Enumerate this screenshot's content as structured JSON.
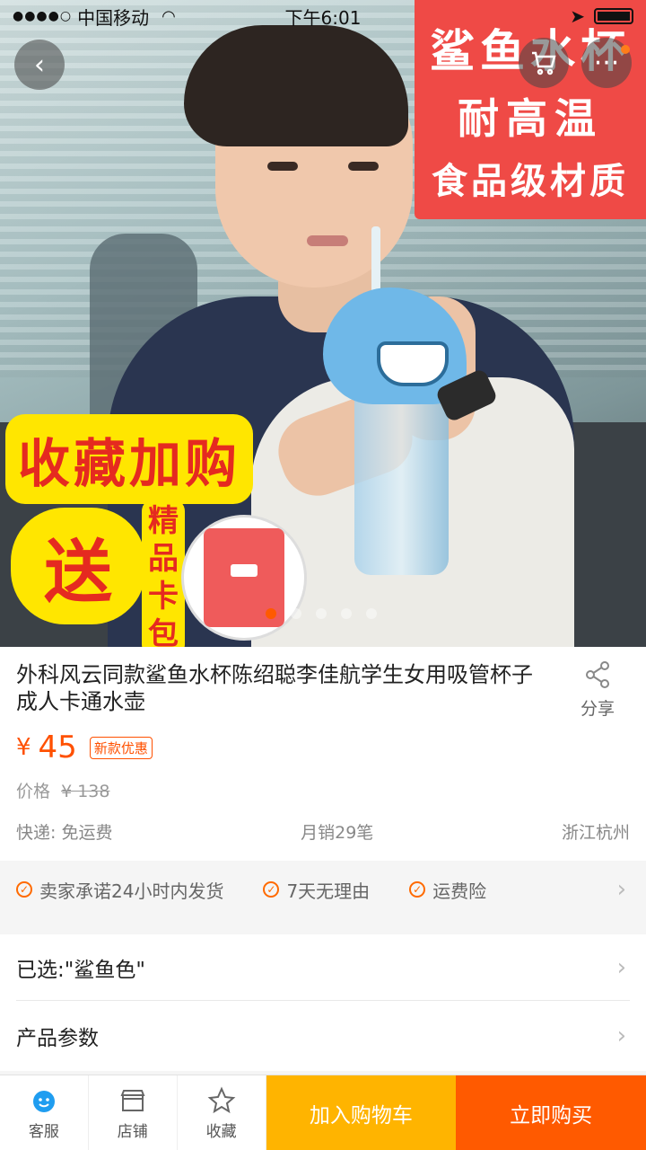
{
  "status_bar": {
    "carrier": "中国移动",
    "time": "下午6:01"
  },
  "promo": {
    "top_lines": [
      "鲨鱼水杯",
      "耐高温",
      "食品级材质"
    ],
    "left_big": "收藏加购",
    "left_gift": "送",
    "left_card": "精品卡包"
  },
  "gallery": {
    "total": 5,
    "current": 1
  },
  "product": {
    "title": "外科风云同款鲨鱼水杯陈绍聪李佳航学生女用吸管杯子成人卡通水壶",
    "share_label": "分享",
    "currency": "¥",
    "price": "45",
    "promo_tag": "新款优惠",
    "original_label": "价格",
    "original_price": "¥ 138",
    "shipping": "快递: 免运费",
    "monthly_sales": "月销29笔",
    "location": "浙江杭州"
  },
  "services": [
    "卖家承诺24小时内发货",
    "7天无理由",
    "运费险"
  ],
  "options": {
    "selected": "已选:\"鲨鱼色\"",
    "params": "产品参数"
  },
  "bottom_bar": {
    "service_label": "客服",
    "shop_label": "店铺",
    "fav_label": "收藏",
    "add_cart": "加入购物车",
    "buy_now": "立即购买"
  },
  "colors": {
    "accent": "#ff5000",
    "cart_button": "#ffb400",
    "buy_button": "#ff5a00"
  }
}
